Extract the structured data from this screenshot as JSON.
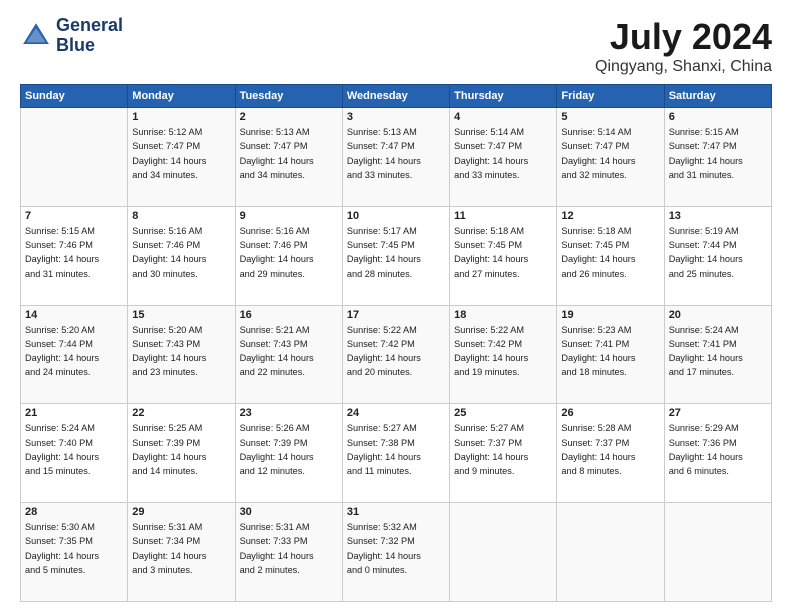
{
  "logo": {
    "line1": "General",
    "line2": "Blue"
  },
  "title": "July 2024",
  "subtitle": "Qingyang, Shanxi, China",
  "days_of_week": [
    "Sunday",
    "Monday",
    "Tuesday",
    "Wednesday",
    "Thursday",
    "Friday",
    "Saturday"
  ],
  "weeks": [
    [
      {
        "day": "",
        "info": ""
      },
      {
        "day": "1",
        "info": "Sunrise: 5:12 AM\nSunset: 7:47 PM\nDaylight: 14 hours\nand 34 minutes."
      },
      {
        "day": "2",
        "info": "Sunrise: 5:13 AM\nSunset: 7:47 PM\nDaylight: 14 hours\nand 34 minutes."
      },
      {
        "day": "3",
        "info": "Sunrise: 5:13 AM\nSunset: 7:47 PM\nDaylight: 14 hours\nand 33 minutes."
      },
      {
        "day": "4",
        "info": "Sunrise: 5:14 AM\nSunset: 7:47 PM\nDaylight: 14 hours\nand 33 minutes."
      },
      {
        "day": "5",
        "info": "Sunrise: 5:14 AM\nSunset: 7:47 PM\nDaylight: 14 hours\nand 32 minutes."
      },
      {
        "day": "6",
        "info": "Sunrise: 5:15 AM\nSunset: 7:47 PM\nDaylight: 14 hours\nand 31 minutes."
      }
    ],
    [
      {
        "day": "7",
        "info": "Sunrise: 5:15 AM\nSunset: 7:46 PM\nDaylight: 14 hours\nand 31 minutes."
      },
      {
        "day": "8",
        "info": "Sunrise: 5:16 AM\nSunset: 7:46 PM\nDaylight: 14 hours\nand 30 minutes."
      },
      {
        "day": "9",
        "info": "Sunrise: 5:16 AM\nSunset: 7:46 PM\nDaylight: 14 hours\nand 29 minutes."
      },
      {
        "day": "10",
        "info": "Sunrise: 5:17 AM\nSunset: 7:45 PM\nDaylight: 14 hours\nand 28 minutes."
      },
      {
        "day": "11",
        "info": "Sunrise: 5:18 AM\nSunset: 7:45 PM\nDaylight: 14 hours\nand 27 minutes."
      },
      {
        "day": "12",
        "info": "Sunrise: 5:18 AM\nSunset: 7:45 PM\nDaylight: 14 hours\nand 26 minutes."
      },
      {
        "day": "13",
        "info": "Sunrise: 5:19 AM\nSunset: 7:44 PM\nDaylight: 14 hours\nand 25 minutes."
      }
    ],
    [
      {
        "day": "14",
        "info": "Sunrise: 5:20 AM\nSunset: 7:44 PM\nDaylight: 14 hours\nand 24 minutes."
      },
      {
        "day": "15",
        "info": "Sunrise: 5:20 AM\nSunset: 7:43 PM\nDaylight: 14 hours\nand 23 minutes."
      },
      {
        "day": "16",
        "info": "Sunrise: 5:21 AM\nSunset: 7:43 PM\nDaylight: 14 hours\nand 22 minutes."
      },
      {
        "day": "17",
        "info": "Sunrise: 5:22 AM\nSunset: 7:42 PM\nDaylight: 14 hours\nand 20 minutes."
      },
      {
        "day": "18",
        "info": "Sunrise: 5:22 AM\nSunset: 7:42 PM\nDaylight: 14 hours\nand 19 minutes."
      },
      {
        "day": "19",
        "info": "Sunrise: 5:23 AM\nSunset: 7:41 PM\nDaylight: 14 hours\nand 18 minutes."
      },
      {
        "day": "20",
        "info": "Sunrise: 5:24 AM\nSunset: 7:41 PM\nDaylight: 14 hours\nand 17 minutes."
      }
    ],
    [
      {
        "day": "21",
        "info": "Sunrise: 5:24 AM\nSunset: 7:40 PM\nDaylight: 14 hours\nand 15 minutes."
      },
      {
        "day": "22",
        "info": "Sunrise: 5:25 AM\nSunset: 7:39 PM\nDaylight: 14 hours\nand 14 minutes."
      },
      {
        "day": "23",
        "info": "Sunrise: 5:26 AM\nSunset: 7:39 PM\nDaylight: 14 hours\nand 12 minutes."
      },
      {
        "day": "24",
        "info": "Sunrise: 5:27 AM\nSunset: 7:38 PM\nDaylight: 14 hours\nand 11 minutes."
      },
      {
        "day": "25",
        "info": "Sunrise: 5:27 AM\nSunset: 7:37 PM\nDaylight: 14 hours\nand 9 minutes."
      },
      {
        "day": "26",
        "info": "Sunrise: 5:28 AM\nSunset: 7:37 PM\nDaylight: 14 hours\nand 8 minutes."
      },
      {
        "day": "27",
        "info": "Sunrise: 5:29 AM\nSunset: 7:36 PM\nDaylight: 14 hours\nand 6 minutes."
      }
    ],
    [
      {
        "day": "28",
        "info": "Sunrise: 5:30 AM\nSunset: 7:35 PM\nDaylight: 14 hours\nand 5 minutes."
      },
      {
        "day": "29",
        "info": "Sunrise: 5:31 AM\nSunset: 7:34 PM\nDaylight: 14 hours\nand 3 minutes."
      },
      {
        "day": "30",
        "info": "Sunrise: 5:31 AM\nSunset: 7:33 PM\nDaylight: 14 hours\nand 2 minutes."
      },
      {
        "day": "31",
        "info": "Sunrise: 5:32 AM\nSunset: 7:32 PM\nDaylight: 14 hours\nand 0 minutes."
      },
      {
        "day": "",
        "info": ""
      },
      {
        "day": "",
        "info": ""
      },
      {
        "day": "",
        "info": ""
      }
    ]
  ]
}
